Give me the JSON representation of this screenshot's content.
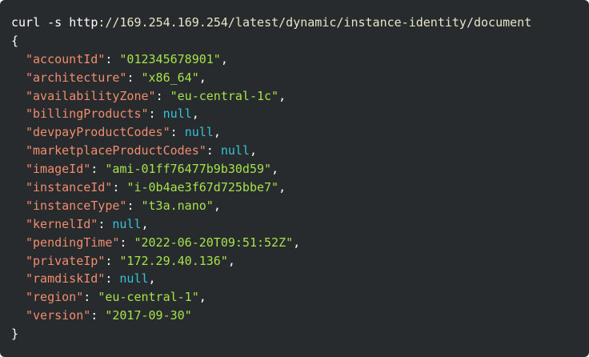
{
  "command": {
    "prefix": "curl -s http",
    "url_rest": "://169.254.169.254/latest/dynamic/instance-identity/document"
  },
  "brace_open": "{",
  "brace_close": "}",
  "fields": [
    {
      "key": "\"accountId\"",
      "value": "\"012345678901\"",
      "type": "string",
      "comma": ","
    },
    {
      "key": "\"architecture\"",
      "value": "\"x86_64\"",
      "type": "string",
      "comma": ","
    },
    {
      "key": "\"availabilityZone\"",
      "value": "\"eu-central-1c\"",
      "type": "string",
      "comma": ","
    },
    {
      "key": "\"billingProducts\"",
      "value": "null",
      "type": "null",
      "comma": ","
    },
    {
      "key": "\"devpayProductCodes\"",
      "value": "null",
      "type": "null",
      "comma": ","
    },
    {
      "key": "\"marketplaceProductCodes\"",
      "value": "null",
      "type": "null",
      "comma": ","
    },
    {
      "key": "\"imageId\"",
      "value": "\"ami-01ff76477b9b30d59\"",
      "type": "string",
      "comma": ","
    },
    {
      "key": "\"instanceId\"",
      "value": "\"i-0b4ae3f67d725bbe7\"",
      "type": "string",
      "comma": ","
    },
    {
      "key": "\"instanceType\"",
      "value": "\"t3a.nano\"",
      "type": "string",
      "comma": ","
    },
    {
      "key": "\"kernelId\"",
      "value": "null",
      "type": "null",
      "comma": ","
    },
    {
      "key": "\"pendingTime\"",
      "value": "\"2022-06-20T09:51:52Z\"",
      "type": "string",
      "comma": ","
    },
    {
      "key": "\"privateIp\"",
      "value": "\"172.29.40.136\"",
      "type": "string",
      "comma": ","
    },
    {
      "key": "\"ramdiskId\"",
      "value": "null",
      "type": "null",
      "comma": ","
    },
    {
      "key": "\"region\"",
      "value": "\"eu-central-1\"",
      "type": "string",
      "comma": ","
    },
    {
      "key": "\"version\"",
      "value": "\"2017-09-30\"",
      "type": "string",
      "comma": ""
    }
  ],
  "colors": {
    "background": "#282b2e",
    "key": "#f18c6c",
    "string": "#a5e24a",
    "null": "#35c4d6",
    "text": "#ffffff"
  }
}
